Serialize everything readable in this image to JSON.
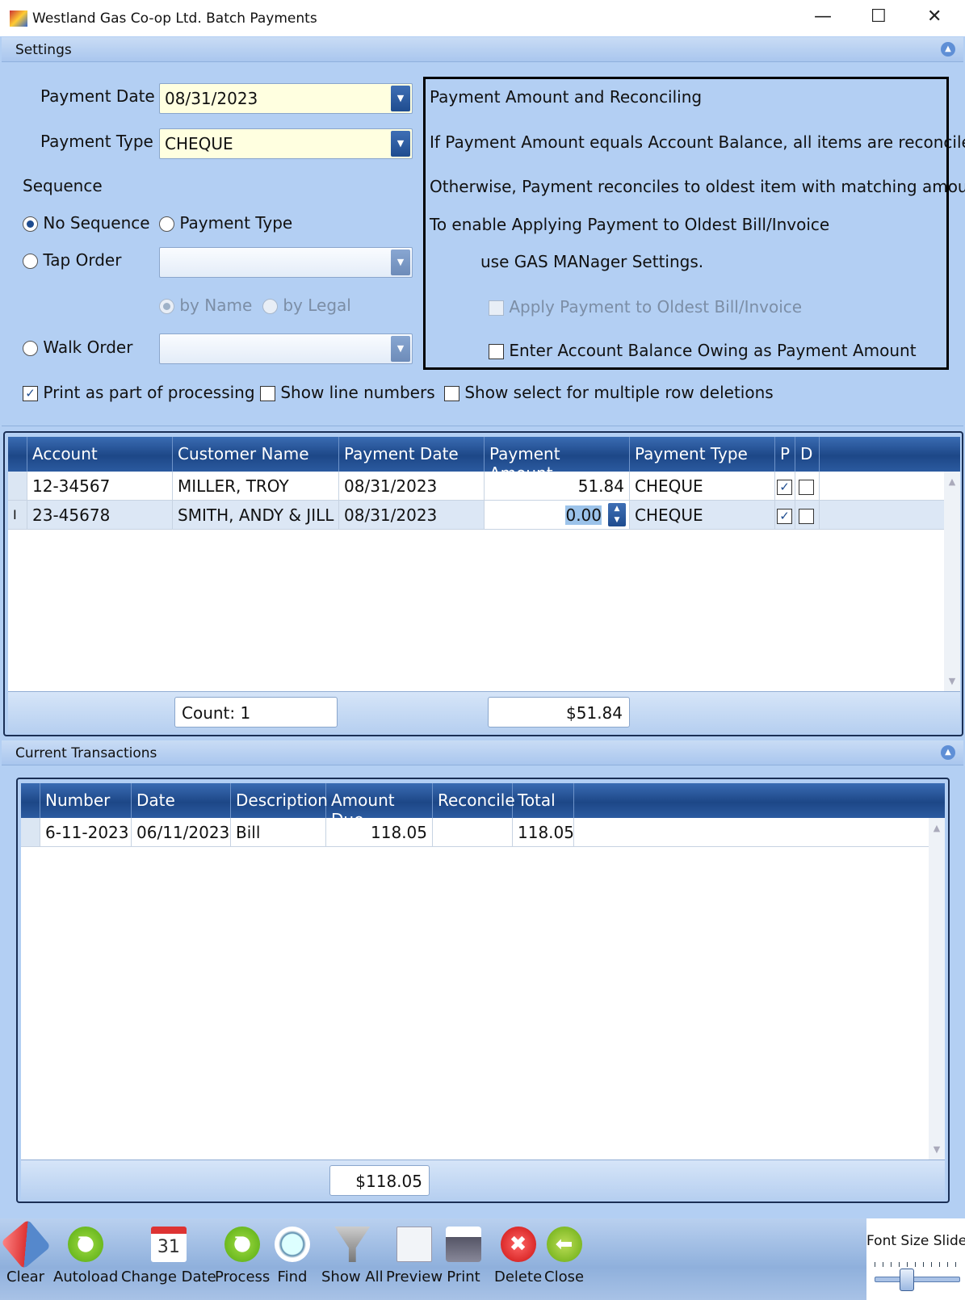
{
  "window": {
    "title": "Westland Gas Co-op Ltd. Batch Payments",
    "minimize": "—",
    "maximize": "☐",
    "close": "✕"
  },
  "settings": {
    "header": "Settings",
    "payment_date_label": "Payment Date",
    "payment_date_value": "08/31/2023",
    "payment_type_label": "Payment Type",
    "payment_type_value": "CHEQUE",
    "sequence_label": "Sequence",
    "no_sequence": "No Sequence",
    "payment_type_radio": "Payment Type",
    "tap_order": "Tap Order",
    "tap_order_value": "",
    "by_name": "by Name",
    "by_legal": "by Legal",
    "walk_order": "Walk Order",
    "walk_order_value": "",
    "print_processing": "Print as part of processing",
    "print_processing_checked": true,
    "show_line_numbers": "Show line numbers",
    "show_line_numbers_checked": false,
    "show_select": "Show select for multiple row deletions",
    "show_select_checked": false,
    "info": {
      "title": "Payment Amount and Reconciling",
      "line1": "If Payment Amount equals Account Balance, all items are reconciled.",
      "line2": "Otherwise, Payment reconciles to oldest item with matching amount.",
      "line3": "To enable Applying Payment to Oldest Bill/Invoice",
      "line4": "use GAS MANager Settings.",
      "apply_oldest": "Apply Payment to Oldest Bill/Invoice",
      "enter_balance": "Enter Account Balance Owing as Payment Amount"
    }
  },
  "payments": {
    "columns": [
      "Account",
      "Customer Name",
      "Payment Date",
      "Payment Amount",
      "Payment Type",
      "P",
      "D"
    ],
    "rows": [
      {
        "account": "12-34567",
        "name": "MILLER, TROY",
        "date": "08/31/2023",
        "amount": "51.84",
        "type": "CHEQUE",
        "p": true,
        "d": false
      },
      {
        "account": "23-45678",
        "name": "SMITH, ANDY & JILL",
        "date": "08/31/2023",
        "amount": "0.00",
        "type": "CHEQUE",
        "p": true,
        "d": false,
        "row_indicator": "I"
      }
    ],
    "count": "Count: 1",
    "total": "$51.84"
  },
  "transactions": {
    "header": "Current Transactions",
    "columns": [
      "Number",
      "Date",
      "Description",
      "Amount Due",
      "Reconcile",
      "Total"
    ],
    "rows": [
      {
        "number": "6-11-2023",
        "date": "06/11/2023",
        "description": "Bill",
        "amount_due": "118.05",
        "reconcile": "",
        "total": "118.05"
      }
    ],
    "total": "$118.05"
  },
  "toolbar": [
    {
      "label": "Clear",
      "icon": "eraser-icon"
    },
    {
      "label": "Autoload",
      "icon": "refresh-icon"
    },
    {
      "label": "Change Date",
      "icon": "calendar-icon",
      "glyph": "31"
    },
    {
      "label": "Process",
      "icon": "refresh-icon"
    },
    {
      "label": "Find",
      "icon": "magnifier-icon"
    },
    {
      "label": "Show All",
      "icon": "funnel-icon"
    },
    {
      "label": "Preview",
      "icon": "preview-icon"
    },
    {
      "label": "Print",
      "icon": "printer-icon"
    },
    {
      "label": "Delete",
      "icon": "delete-icon"
    },
    {
      "label": "Close",
      "icon": "back-arrow-icon"
    }
  ],
  "font_slider": {
    "label": "Font Size Slider",
    "level_percent": 35
  }
}
